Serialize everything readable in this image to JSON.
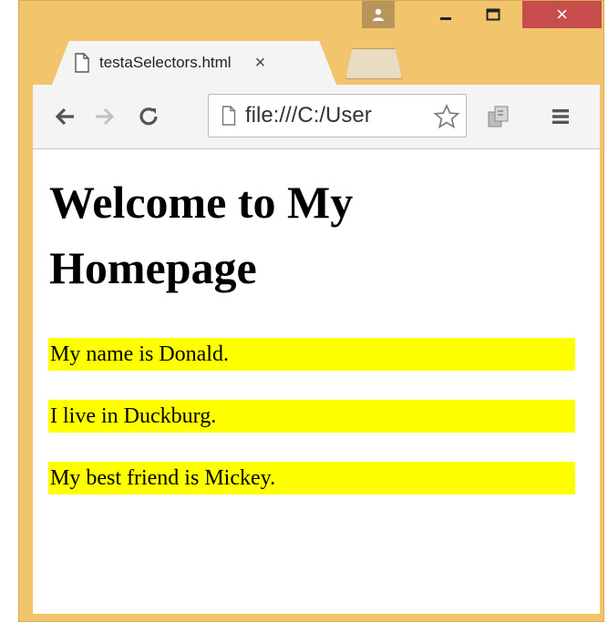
{
  "browser": {
    "tab": {
      "title": "testaSelectors.html",
      "close_glyph": "×"
    },
    "window_controls": {
      "close_glyph": "×"
    },
    "omnibox": {
      "url": "file:///C:/User"
    },
    "icons": [
      "profile-icon",
      "minimize-icon",
      "maximize-icon",
      "close-icon",
      "page-icon",
      "back-arrow-icon",
      "forward-arrow-icon",
      "reload-icon",
      "star-icon",
      "extensions-icon",
      "menu-icon"
    ]
  },
  "page": {
    "heading": "Welcome to My Homepage",
    "paragraphs": [
      "My name is Donald.",
      "I live in Duckburg.",
      "My best friend is Mickey."
    ],
    "highlight_color": "#ffff00"
  },
  "colors": {
    "frame": "#f2c46c",
    "close_button": "#c74d4d"
  }
}
